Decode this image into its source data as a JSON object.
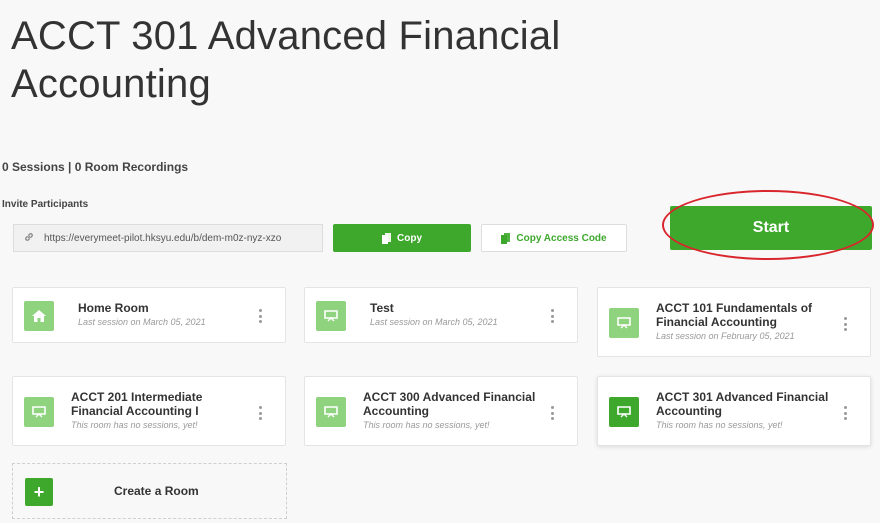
{
  "room": {
    "title": "ACCT 301 Advanced Financial Accounting"
  },
  "stats": "0 Sessions | 0 Room Recordings",
  "invite": {
    "label": "Invite Participants",
    "url": "https://everymeet-pilot.hksyu.edu/b/dem-m0z-nyz-xzo",
    "copy_label": "Copy",
    "copy_code_label": "Copy Access Code"
  },
  "start_label": "Start",
  "rooms": [
    {
      "name": "Home Room",
      "sub": "Last session on March 05, 2021",
      "icon": "home-icon"
    },
    {
      "name": "Test",
      "sub": "Last session on March 05, 2021",
      "icon": "presentation-icon"
    },
    {
      "name": "ACCT 101 Fundamentals of Financial Accounting",
      "sub": "Last session on February 05, 2021",
      "icon": "presentation-icon"
    },
    {
      "name": "ACCT 201 Intermediate Financial Accounting I",
      "sub": "This room has no sessions, yet!",
      "icon": "presentation-icon"
    },
    {
      "name": "ACCT 300 Advanced Financial Accounting",
      "sub": "This room has no sessions, yet!",
      "icon": "presentation-icon"
    },
    {
      "name": "ACCT 301 Advanced Financial Accounting",
      "sub": "This room has no sessions, yet!",
      "icon": "presentation-icon",
      "selected": true
    }
  ],
  "create_room_label": "Create a Room",
  "colors": {
    "primary": "#3ea82d",
    "icon_light": "#8fd37f",
    "annotation": "#d9262c"
  }
}
